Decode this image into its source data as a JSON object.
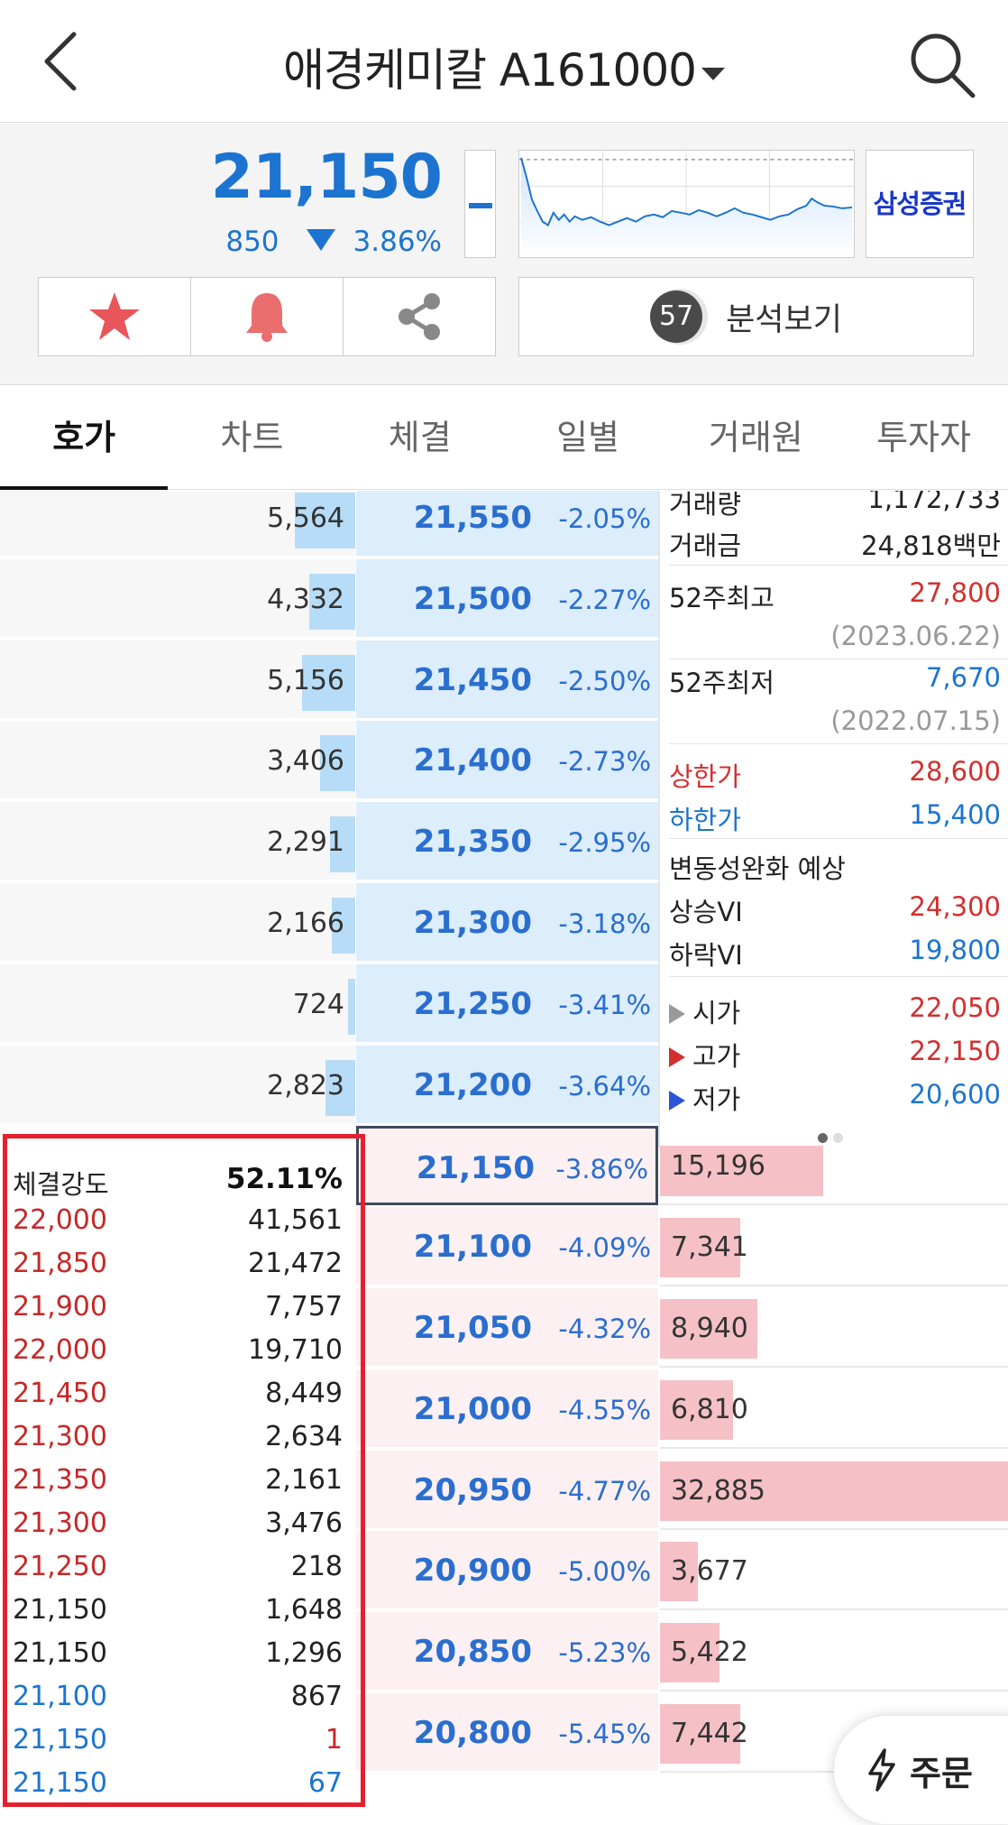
{
  "header": {
    "title": "애경케미칼 A161000",
    "icons": [
      "back-arrow-icon",
      "dropdown-triangle-icon",
      "search-icon"
    ]
  },
  "quote": {
    "price": "21,150",
    "change": "850",
    "change_pct": "3.86%",
    "broker": "삼성증권",
    "analysis_score": "57",
    "analysis_label": "분석보기",
    "actions": [
      "star-icon",
      "bell-icon",
      "share-icon"
    ],
    "colors": {
      "up": "#d32f2f",
      "down": "#1c74d0"
    }
  },
  "tabs": [
    {
      "label": "호가",
      "active": true
    },
    {
      "label": "차트"
    },
    {
      "label": "체결"
    },
    {
      "label": "일별"
    },
    {
      "label": "거래원"
    },
    {
      "label": "투자자"
    }
  ],
  "asks": [
    {
      "qty": "5,564",
      "qty_frac": 0.17,
      "price": "21,550",
      "pct": "-2.05%"
    },
    {
      "qty": "4,332",
      "qty_frac": 0.13,
      "price": "21,500",
      "pct": "-2.27%"
    },
    {
      "qty": "5,156",
      "qty_frac": 0.15,
      "price": "21,450",
      "pct": "-2.50%"
    },
    {
      "qty": "3,406",
      "qty_frac": 0.1,
      "price": "21,400",
      "pct": "-2.73%"
    },
    {
      "qty": "2,291",
      "qty_frac": 0.07,
      "price": "21,350",
      "pct": "-2.95%"
    },
    {
      "qty": "2,166",
      "qty_frac": 0.065,
      "price": "21,300",
      "pct": "-3.18%"
    },
    {
      "qty": "724",
      "qty_frac": 0.02,
      "price": "21,250",
      "pct": "-3.41%"
    },
    {
      "qty": "2,823",
      "qty_frac": 0.085,
      "price": "21,200",
      "pct": "-3.64%"
    }
  ],
  "bids": [
    {
      "price": "21,150",
      "pct": "-3.86%",
      "qty": "15,196",
      "qty_frac": 0.47,
      "current": true
    },
    {
      "price": "21,100",
      "pct": "-4.09%",
      "qty": "7,341",
      "qty_frac": 0.23
    },
    {
      "price": "21,050",
      "pct": "-4.32%",
      "qty": "8,940",
      "qty_frac": 0.28
    },
    {
      "price": "21,000",
      "pct": "-4.55%",
      "qty": "6,810",
      "qty_frac": 0.21
    },
    {
      "price": "20,950",
      "pct": "-4.77%",
      "qty": "32,885",
      "qty_frac": 1.0
    },
    {
      "price": "20,900",
      "pct": "-5.00%",
      "qty": "3,677",
      "qty_frac": 0.11
    },
    {
      "price": "20,850",
      "pct": "-5.23%",
      "qty": "5,422",
      "qty_frac": 0.17
    },
    {
      "price": "20,800",
      "pct": "-5.45%",
      "qty": "7,442",
      "qty_frac": 0.23
    }
  ],
  "info": {
    "volume_label": "거래량",
    "volume": "1,172,733",
    "amount_label": "거래금",
    "amount": "24,818백만",
    "high52_label": "52주최고",
    "high52": "27,800",
    "high52_date": "(2023.06.22)",
    "low52_label": "52주최저",
    "low52": "7,670",
    "low52_date": "(2022.07.15)",
    "upper_label": "상한가",
    "upper": "28,600",
    "lower_label": "하한가",
    "lower": "15,400",
    "vi_title": "변동성완화 예상",
    "vi_up_label": "상승VI",
    "vi_up": "24,300",
    "vi_down_label": "하락VI",
    "vi_down": "19,800",
    "open_label": "시가",
    "open": "22,050",
    "high_label": "고가",
    "high": "22,150",
    "low_label": "저가",
    "low": "20,600"
  },
  "trade_strength": {
    "label": "체결강도",
    "value": "52.11%",
    "rows": [
      {
        "price": "22,000",
        "qty": "41,561",
        "pcolor": "red",
        "qcolor": "black"
      },
      {
        "price": "21,850",
        "qty": "21,472",
        "pcolor": "red",
        "qcolor": "black"
      },
      {
        "price": "21,900",
        "qty": "7,757",
        "pcolor": "red",
        "qcolor": "black"
      },
      {
        "price": "22,000",
        "qty": "19,710",
        "pcolor": "red",
        "qcolor": "black"
      },
      {
        "price": "21,450",
        "qty": "8,449",
        "pcolor": "red",
        "qcolor": "black"
      },
      {
        "price": "21,300",
        "qty": "2,634",
        "pcolor": "red",
        "qcolor": "black"
      },
      {
        "price": "21,350",
        "qty": "2,161",
        "pcolor": "red",
        "qcolor": "black"
      },
      {
        "price": "21,300",
        "qty": "3,476",
        "pcolor": "red",
        "qcolor": "black"
      },
      {
        "price": "21,250",
        "qty": "218",
        "pcolor": "red",
        "qcolor": "black"
      },
      {
        "price": "21,150",
        "qty": "1,648",
        "pcolor": "black",
        "qcolor": "black"
      },
      {
        "price": "21,150",
        "qty": "1,296",
        "pcolor": "black",
        "qcolor": "black"
      },
      {
        "price": "21,100",
        "qty": "867",
        "pcolor": "blue",
        "qcolor": "black"
      },
      {
        "price": "21,150",
        "qty": "1",
        "pcolor": "blue",
        "qcolor": "red"
      },
      {
        "price": "21,150",
        "qty": "67",
        "pcolor": "blue",
        "qcolor": "blue"
      }
    ]
  },
  "order_button": {
    "label": "주문",
    "icon": "lightning-icon"
  }
}
